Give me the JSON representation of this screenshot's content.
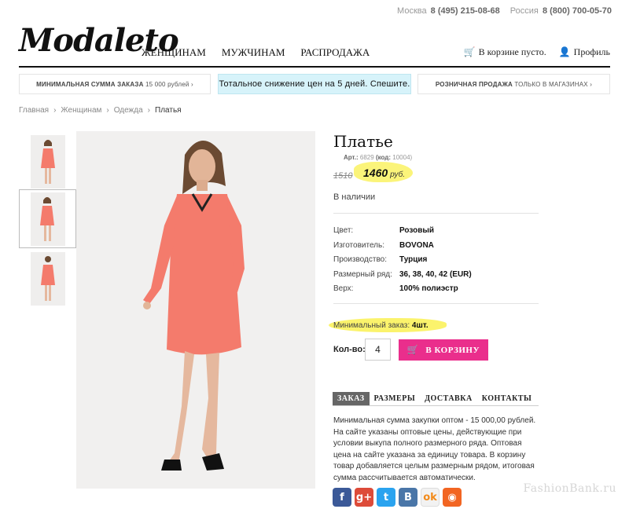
{
  "topbar": {
    "city1": "Москва",
    "phone1": "8 (495) 215-08-68",
    "city2": "Россия",
    "phone2": "8 (800) 700-05-70"
  },
  "logo": "Modaleto",
  "nav": [
    "ЖЕНЩИНАМ",
    "МУЖЧИНАМ",
    "РАСПРОДАЖА"
  ],
  "cart_label": "В корзине пусто.",
  "profile_label": "Профиль",
  "promos": {
    "left_bold": "МИНИМАЛЬНАЯ СУММА ЗАКАЗА",
    "left_rest": "15 000 рублей ›",
    "center": "Тотальное снижение цен на 5 дней. Спешите.",
    "right_bold": "РОЗНИЧНАЯ ПРОДАЖА",
    "right_rest": "ТОЛЬКО В МАГАЗИНАХ ›"
  },
  "breadcrumb": [
    "Главная",
    "Женщинам",
    "Одежда",
    "Платья"
  ],
  "breadcrumb_sep": "›",
  "product": {
    "title": "Платье",
    "art_label": "Арт.:",
    "art_value": "6829",
    "code_label": "(код:",
    "code_value": "10004)",
    "old_price": "1510",
    "new_price": "1460",
    "currency": "руб.",
    "stock": "В наличии",
    "props": [
      {
        "k": "Цвет:",
        "v": "Розовый"
      },
      {
        "k": "Изготовитель:",
        "v": "BOVONA"
      },
      {
        "k": "Производство:",
        "v": "Турция"
      },
      {
        "k": "Размерный ряд:",
        "v": "36, 38, 40, 42 (EUR)"
      },
      {
        "k": "Верх:",
        "v": "100% полиэстр"
      }
    ],
    "min_order_label": "Минимальный заказ:",
    "min_order_value": "4шт.",
    "qty_label": "Кол-во:",
    "qty_value": "4",
    "cart_button": "В КОРЗИНУ"
  },
  "tabs": [
    "ЗАКАЗ",
    "РАЗМЕРЫ",
    "ДОСТАВКА",
    "КОНТАКТЫ"
  ],
  "tab_text": "Минимальная сумма закупки оптом - 15 000,00 рублей. На сайте указаны оптовые цены, действующие при условии выкупа полного размерного ряда. Оптовая цена на сайте указана за единицу товара. В корзину товар добавляется целым размерным рядом, итоговая сумма рассчитывается автоматически.",
  "social": [
    {
      "icon": "facebook-icon",
      "glyph": "f",
      "color": "#3b5998"
    },
    {
      "icon": "google-plus-icon",
      "glyph": "g+",
      "color": "#dd4b39"
    },
    {
      "icon": "twitter-icon",
      "glyph": "t",
      "color": "#2aa3ef"
    },
    {
      "icon": "vkontakte-icon",
      "glyph": "B",
      "color": "#4a76a8"
    },
    {
      "icon": "odnoklassniki-icon",
      "glyph": "ok",
      "color": "#f2f2f2"
    },
    {
      "icon": "rss-icon",
      "glyph": "◉",
      "color": "#f26522"
    }
  ],
  "watermark": "FashionBank.ru",
  "colors": {
    "accent": "#ea2e8c",
    "highlight": "#fbf36c",
    "promo_bg": "#d7f3fa",
    "dress": "#f47b6c"
  }
}
